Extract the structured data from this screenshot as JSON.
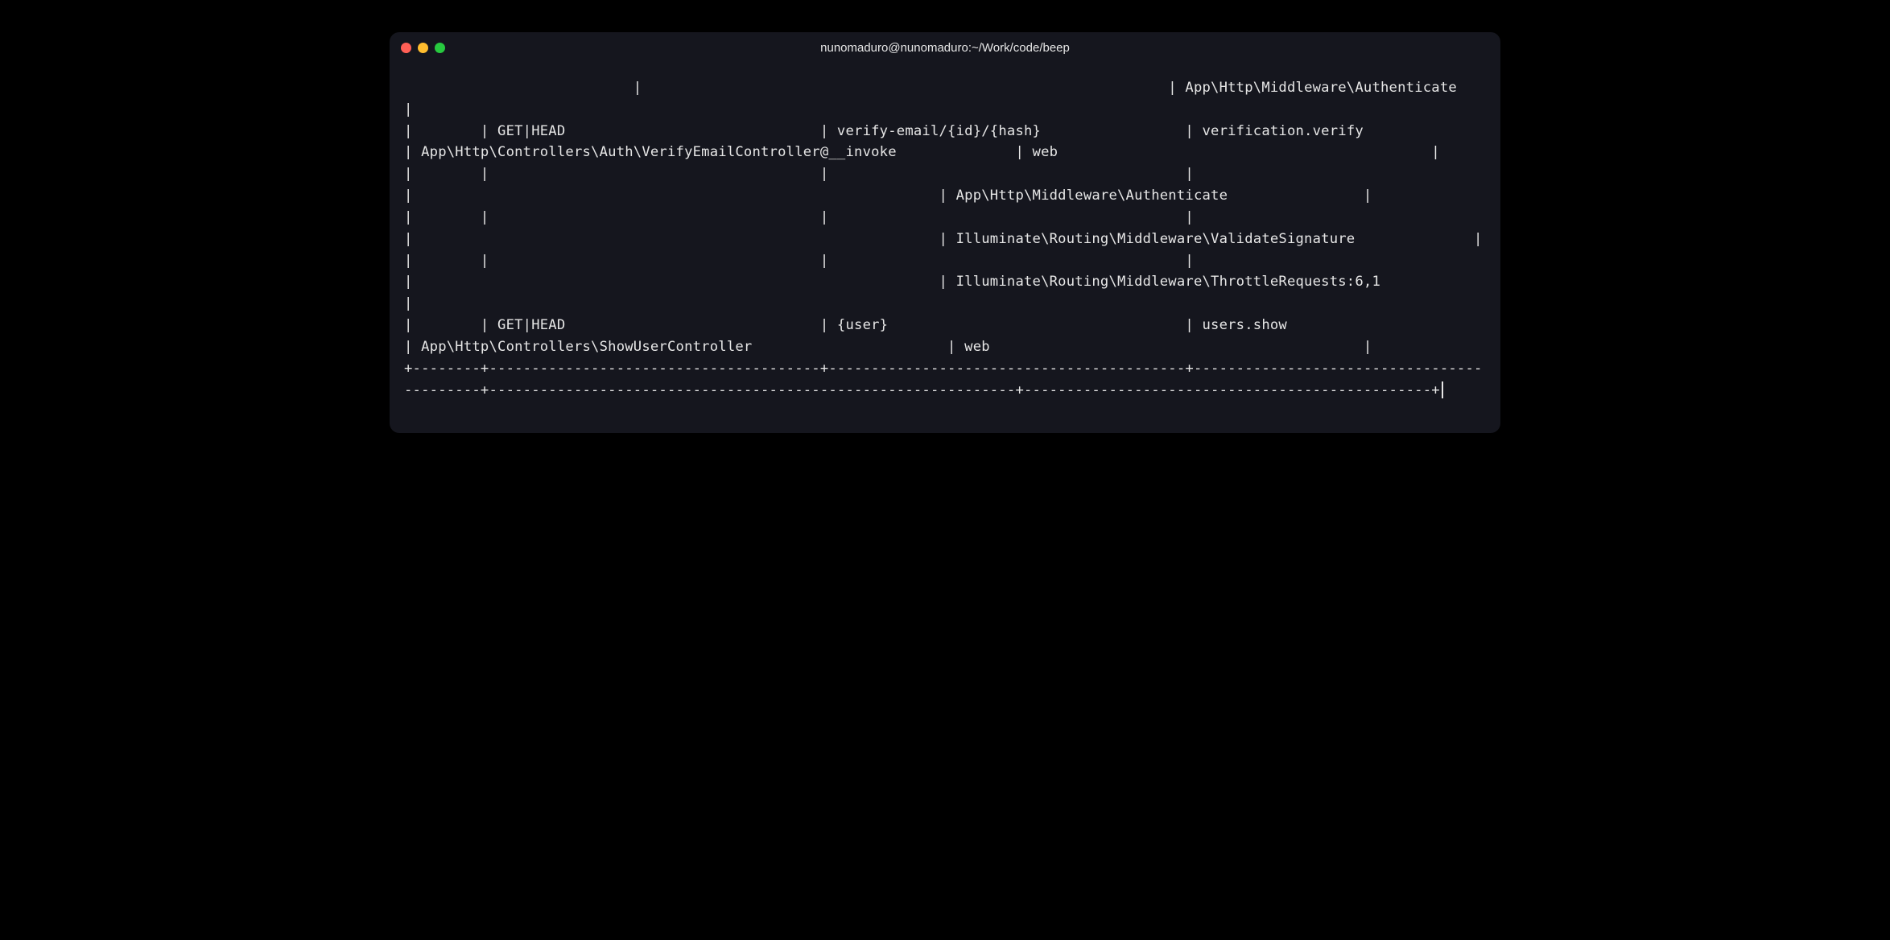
{
  "window": {
    "title": "nunomaduro@nunomaduro:~/Work/code/beep"
  },
  "terminal": {
    "lines": [
      "                           |                                                              | App\\Http\\Middleware\\Authenticate                |",
      "|        | GET|HEAD                              | verify-email/{id}/{hash}                 | verification.verify                       | App\\Http\\Controllers\\Auth\\VerifyEmailController@__invoke              | web                                            |",
      "|        |                                       |                                          |                                           |                                                              | App\\Http\\Middleware\\Authenticate                |",
      "|        |                                       |                                          |                                           |                                                              | Illuminate\\Routing\\Middleware\\ValidateSignature              |",
      "|        |                                       |                                          |                                           |                                                              | Illuminate\\Routing\\Middleware\\ThrottleRequests:6,1            |",
      "|        | GET|HEAD                              | {user}                                   | users.show                                | App\\Http\\Controllers\\ShowUserController                       | web                                            |",
      "+--------+---------------------------------------+------------------------------------------+-------------------------------------------+--------------------------------------------------------------+------------------------------------------------+"
    ]
  }
}
